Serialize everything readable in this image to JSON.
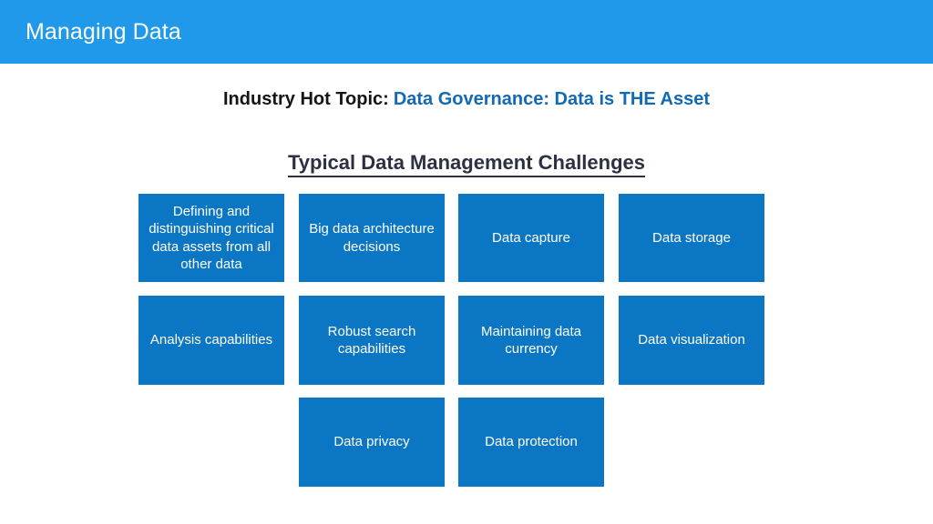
{
  "header": {
    "title": "Managing Data",
    "bar_color": "#2199ea"
  },
  "subtitle": {
    "lead": "Industry Hot Topic:",
    "topic": "Data Governance: Data is THE Asset",
    "lead_color": "#151515",
    "topic_color": "#1269b4"
  },
  "section": {
    "heading": "Typical Data Management Challenges",
    "heading_color": "#2c3142"
  },
  "challenges": {
    "tile_color": "#0b76c3",
    "tile_text_color": "#ffffff",
    "rows": [
      {
        "cells": [
          {
            "label": "Defining and distinguishing critical data assets from all other data",
            "column": 1
          },
          {
            "label": "Big data architecture decisions",
            "column": 2
          },
          {
            "label": "Data capture",
            "column": 3
          },
          {
            "label": "Data storage",
            "column": 4
          }
        ]
      },
      {
        "cells": [
          {
            "label": "Analysis capabilities",
            "column": 1
          },
          {
            "label": "Robust search capabilities",
            "column": 2
          },
          {
            "label": "Maintaining data currency",
            "column": 3
          },
          {
            "label": "Data visualization",
            "column": 4
          }
        ]
      },
      {
        "cells": [
          {
            "label": "Data privacy",
            "column": 2
          },
          {
            "label": "Data protection",
            "column": 3
          }
        ]
      }
    ]
  }
}
